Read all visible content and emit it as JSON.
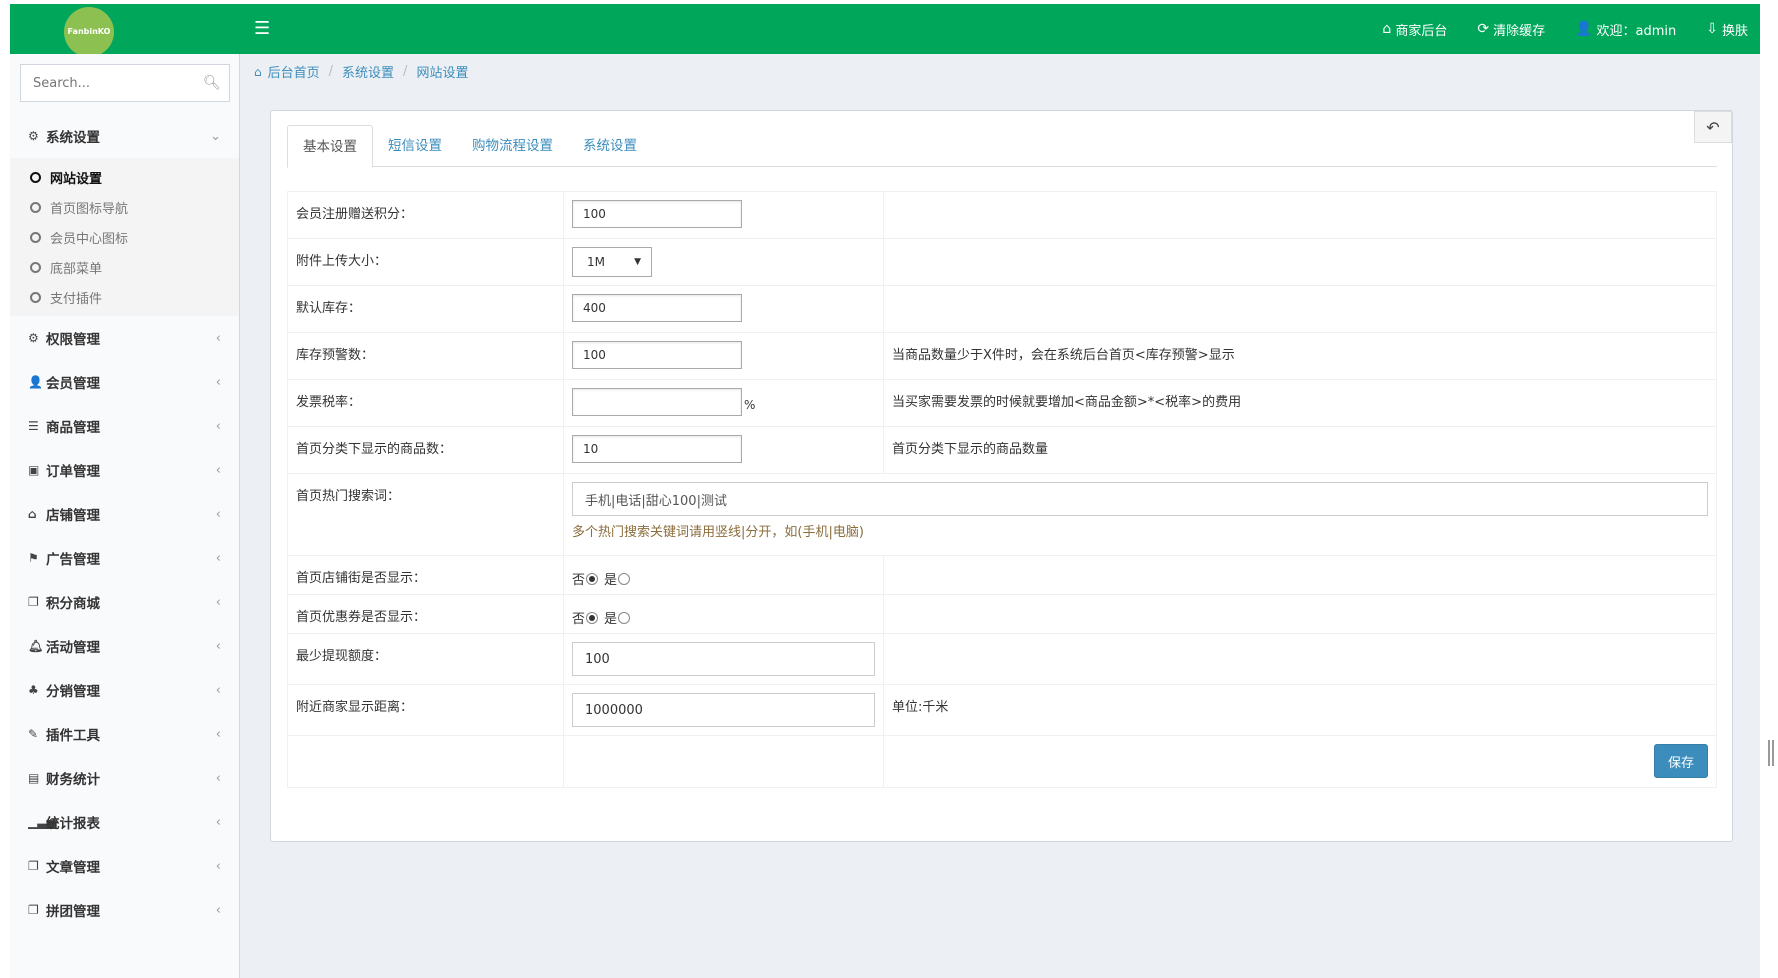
{
  "header": {
    "logo_text": "FanbinKO",
    "nav": [
      {
        "icon": "home-icon",
        "label": "商家后台"
      },
      {
        "icon": "refresh-icon",
        "label": "清除缓存"
      },
      {
        "icon": "user-icon",
        "label": "欢迎：admin"
      },
      {
        "icon": "skin-icon",
        "label": "换肤"
      }
    ],
    "accent_color": "#00a65a"
  },
  "sidebar": {
    "search_placeholder": "Search...",
    "groups": [
      {
        "label": "系统设置",
        "expanded": true,
        "items": [
          {
            "label": "网站设置",
            "active": true
          },
          {
            "label": "首页图标导航"
          },
          {
            "label": "会员中心图标"
          },
          {
            "label": "底部菜单"
          },
          {
            "label": "支付插件"
          }
        ]
      },
      {
        "label": "权限管理"
      },
      {
        "label": "会员管理"
      },
      {
        "label": "商品管理"
      },
      {
        "label": "订单管理"
      },
      {
        "label": "店铺管理"
      },
      {
        "label": "广告管理"
      },
      {
        "label": "积分商城"
      },
      {
        "label": "活动管理"
      },
      {
        "label": "分销管理"
      },
      {
        "label": "插件工具"
      },
      {
        "label": "财务统计"
      },
      {
        "label": "统计报表"
      },
      {
        "label": "文章管理"
      },
      {
        "label": "拼团管理"
      }
    ]
  },
  "breadcrumb": [
    "后台首页",
    "系统设置",
    "网站设置"
  ],
  "tabs": [
    {
      "label": "基本设置",
      "active": true
    },
    {
      "label": "短信设置"
    },
    {
      "label": "购物流程设置"
    },
    {
      "label": "系统设置"
    }
  ],
  "form": {
    "register_points": {
      "label": "会员注册赠送积分：",
      "value": "100"
    },
    "upload_size": {
      "label": "附件上传大小：",
      "value": "1M"
    },
    "default_stock": {
      "label": "默认库存：",
      "value": "400"
    },
    "stock_warning": {
      "label": "库存预警数：",
      "value": "100",
      "hint": "当商品数量少于X件时，会在系统后台首页<库存预警>显示"
    },
    "invoice_tax": {
      "label": "发票税率：",
      "value": "",
      "unit": "%",
      "hint": "当买家需要发票的时候就要增加<商品金额>*<税率>的费用"
    },
    "home_category_count": {
      "label": "首页分类下显示的商品数：",
      "value": "10",
      "hint": "首页分类下显示的商品数量"
    },
    "hot_keywords": {
      "label": "首页热门搜索词：",
      "value": "手机|电话|甜心100|测试",
      "help": "多个热门搜索关键词请用竖线|分开，如(手机|电脑)"
    },
    "show_shop_street": {
      "label": "首页店铺街是否显示：",
      "no": "否",
      "yes": "是",
      "selected": "否"
    },
    "show_coupon": {
      "label": "首页优惠券是否显示：",
      "no": "否",
      "yes": "是",
      "selected": "否"
    },
    "min_withdraw": {
      "label": "最少提现额度：",
      "value": "100"
    },
    "nearby_distance": {
      "label": "附近商家显示距离：",
      "value": "1000000",
      "hint": "单位:千米"
    },
    "save_label": "保存"
  }
}
